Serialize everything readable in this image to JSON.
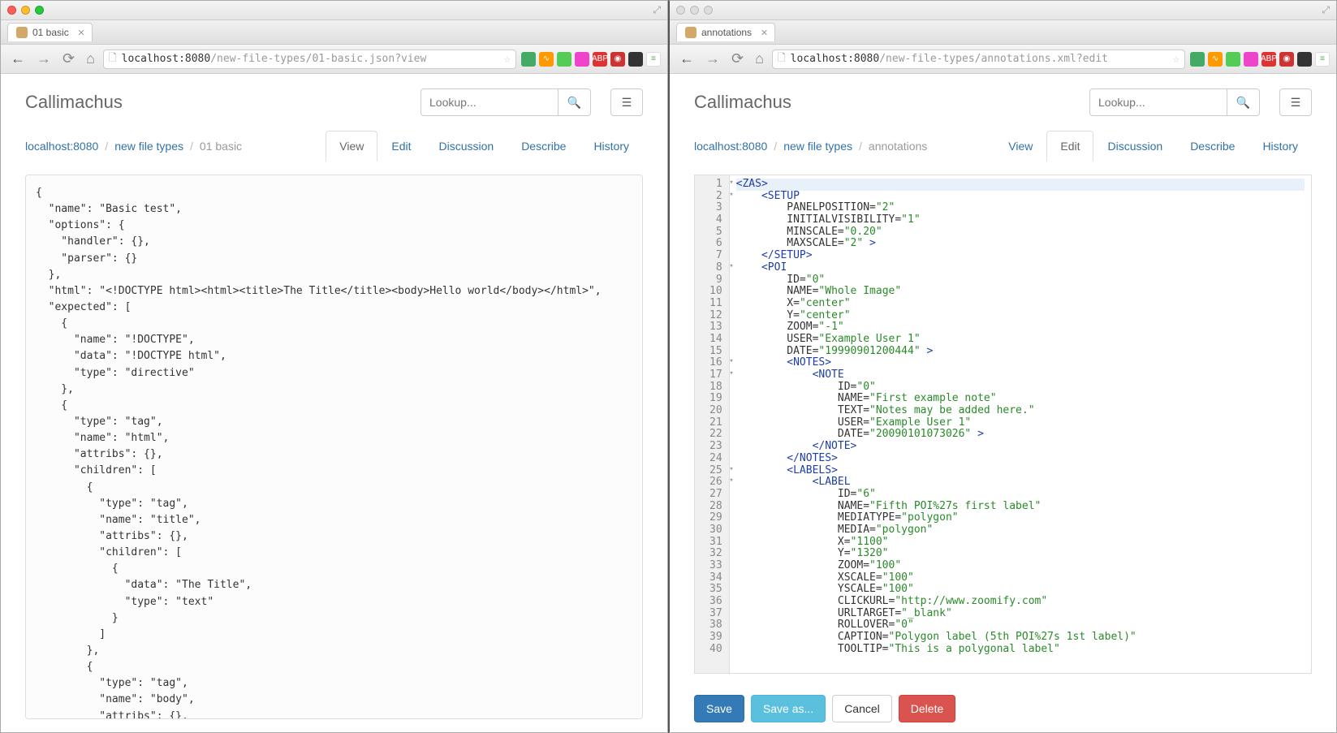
{
  "left": {
    "tab_title": "01 basic",
    "url_host": "localhost",
    "url_port": ":8080",
    "url_path": "/new-file-types/01-basic.json?view",
    "app_title": "Callimachus",
    "lookup_placeholder": "Lookup...",
    "breadcrumb": {
      "a": "localhost:8080",
      "b": "new file types",
      "c": "01 basic"
    },
    "tabs": [
      "View",
      "Edit",
      "Discussion",
      "Describe",
      "History"
    ],
    "active_tab": "View",
    "json_text": "{\n  \"name\": \"Basic test\",\n  \"options\": {\n    \"handler\": {},\n    \"parser\": {}\n  },\n  \"html\": \"<!DOCTYPE html><html><title>The Title</title><body>Hello world</body></html>\",\n  \"expected\": [\n    {\n      \"name\": \"!DOCTYPE\",\n      \"data\": \"!DOCTYPE html\",\n      \"type\": \"directive\"\n    },\n    {\n      \"type\": \"tag\",\n      \"name\": \"html\",\n      \"attribs\": {},\n      \"children\": [\n        {\n          \"type\": \"tag\",\n          \"name\": \"title\",\n          \"attribs\": {},\n          \"children\": [\n            {\n              \"data\": \"The Title\",\n              \"type\": \"text\"\n            }\n          ]\n        },\n        {\n          \"type\": \"tag\",\n          \"name\": \"body\",\n          \"attribs\": {},\n          \"children\": [\n            {\n              \"data\": \"Hello world\",\n              \"type\": \"text\""
  },
  "right": {
    "tab_title": "annotations",
    "url_host": "localhost",
    "url_port": ":8080",
    "url_path": "/new-file-types/annotations.xml?edit",
    "app_title": "Callimachus",
    "lookup_placeholder": "Lookup...",
    "breadcrumb": {
      "a": "localhost:8080",
      "b": "new file types",
      "c": "annotations"
    },
    "tabs": [
      "View",
      "Edit",
      "Discussion",
      "Describe",
      "History"
    ],
    "active_tab": "Edit",
    "buttons": {
      "save": "Save",
      "saveas": "Save as...",
      "cancel": "Cancel",
      "delete": "Delete"
    },
    "code_lines": [
      {
        "n": 1,
        "fold": true,
        "hl": true,
        "parts": [
          {
            "c": "t-tag",
            "t": "<ZAS>"
          }
        ]
      },
      {
        "n": 2,
        "fold": true,
        "parts": [
          {
            "t": "    "
          },
          {
            "c": "t-tag",
            "t": "<SETUP"
          }
        ]
      },
      {
        "n": 3,
        "parts": [
          {
            "t": "        "
          },
          {
            "c": "t-attr",
            "t": "PANELPOSITION="
          },
          {
            "c": "t-str",
            "t": "\"2\""
          }
        ]
      },
      {
        "n": 4,
        "parts": [
          {
            "t": "        "
          },
          {
            "c": "t-attr",
            "t": "INITIALVISIBILITY="
          },
          {
            "c": "t-str",
            "t": "\"1\""
          }
        ]
      },
      {
        "n": 5,
        "parts": [
          {
            "t": "        "
          },
          {
            "c": "t-attr",
            "t": "MINSCALE="
          },
          {
            "c": "t-str",
            "t": "\"0.20\""
          }
        ]
      },
      {
        "n": 6,
        "parts": [
          {
            "t": "        "
          },
          {
            "c": "t-attr",
            "t": "MAXSCALE="
          },
          {
            "c": "t-str",
            "t": "\"2\""
          },
          {
            "c": "t-tag",
            "t": " >"
          }
        ]
      },
      {
        "n": 7,
        "parts": [
          {
            "t": "    "
          },
          {
            "c": "t-tag",
            "t": "</SETUP>"
          }
        ]
      },
      {
        "n": 8,
        "fold": true,
        "parts": [
          {
            "t": "    "
          },
          {
            "c": "t-tag",
            "t": "<POI"
          }
        ]
      },
      {
        "n": 9,
        "parts": [
          {
            "t": "        "
          },
          {
            "c": "t-attr",
            "t": "ID="
          },
          {
            "c": "t-str",
            "t": "\"0\""
          }
        ]
      },
      {
        "n": 10,
        "parts": [
          {
            "t": "        "
          },
          {
            "c": "t-attr",
            "t": "NAME="
          },
          {
            "c": "t-str",
            "t": "\"Whole Image\""
          }
        ]
      },
      {
        "n": 11,
        "parts": [
          {
            "t": "        "
          },
          {
            "c": "t-attr",
            "t": "X="
          },
          {
            "c": "t-str",
            "t": "\"center\""
          }
        ]
      },
      {
        "n": 12,
        "parts": [
          {
            "t": "        "
          },
          {
            "c": "t-attr",
            "t": "Y="
          },
          {
            "c": "t-str",
            "t": "\"center\""
          }
        ]
      },
      {
        "n": 13,
        "parts": [
          {
            "t": "        "
          },
          {
            "c": "t-attr",
            "t": "ZOOM="
          },
          {
            "c": "t-str",
            "t": "\"-1\""
          }
        ]
      },
      {
        "n": 14,
        "parts": [
          {
            "t": "        "
          },
          {
            "c": "t-attr",
            "t": "USER="
          },
          {
            "c": "t-str",
            "t": "\"Example User 1\""
          }
        ]
      },
      {
        "n": 15,
        "parts": [
          {
            "t": "        "
          },
          {
            "c": "t-attr",
            "t": "DATE="
          },
          {
            "c": "t-str",
            "t": "\"19990901200444\""
          },
          {
            "c": "t-tag",
            "t": " >"
          }
        ]
      },
      {
        "n": 16,
        "fold": true,
        "parts": [
          {
            "t": "        "
          },
          {
            "c": "t-tag",
            "t": "<NOTES>"
          }
        ]
      },
      {
        "n": 17,
        "fold": true,
        "parts": [
          {
            "t": "            "
          },
          {
            "c": "t-tag",
            "t": "<NOTE"
          }
        ]
      },
      {
        "n": 18,
        "parts": [
          {
            "t": "                "
          },
          {
            "c": "t-attr",
            "t": "ID="
          },
          {
            "c": "t-str",
            "t": "\"0\""
          }
        ]
      },
      {
        "n": 19,
        "parts": [
          {
            "t": "                "
          },
          {
            "c": "t-attr",
            "t": "NAME="
          },
          {
            "c": "t-str",
            "t": "\"First example note\""
          }
        ]
      },
      {
        "n": 20,
        "parts": [
          {
            "t": "                "
          },
          {
            "c": "t-attr",
            "t": "TEXT="
          },
          {
            "c": "t-str",
            "t": "\"Notes may be added here.\""
          }
        ]
      },
      {
        "n": 21,
        "parts": [
          {
            "t": "                "
          },
          {
            "c": "t-attr",
            "t": "USER="
          },
          {
            "c": "t-str",
            "t": "\"Example User 1\""
          }
        ]
      },
      {
        "n": 22,
        "parts": [
          {
            "t": "                "
          },
          {
            "c": "t-attr",
            "t": "DATE="
          },
          {
            "c": "t-str",
            "t": "\"20090101073026\""
          },
          {
            "c": "t-tag",
            "t": " >"
          }
        ]
      },
      {
        "n": 23,
        "parts": [
          {
            "t": "            "
          },
          {
            "c": "t-tag",
            "t": "</NOTE>"
          }
        ]
      },
      {
        "n": 24,
        "parts": [
          {
            "t": "        "
          },
          {
            "c": "t-tag",
            "t": "</NOTES>"
          }
        ]
      },
      {
        "n": 25,
        "fold": true,
        "parts": [
          {
            "t": "        "
          },
          {
            "c": "t-tag",
            "t": "<LABELS>"
          }
        ]
      },
      {
        "n": 26,
        "fold": true,
        "parts": [
          {
            "t": "            "
          },
          {
            "c": "t-tag",
            "t": "<LABEL"
          }
        ]
      },
      {
        "n": 27,
        "parts": [
          {
            "t": "                "
          },
          {
            "c": "t-attr",
            "t": "ID="
          },
          {
            "c": "t-str",
            "t": "\"6\""
          }
        ]
      },
      {
        "n": 28,
        "parts": [
          {
            "t": "                "
          },
          {
            "c": "t-attr",
            "t": "NAME="
          },
          {
            "c": "t-str",
            "t": "\"Fifth POI%27s first label\""
          }
        ]
      },
      {
        "n": 29,
        "parts": [
          {
            "t": "                "
          },
          {
            "c": "t-attr",
            "t": "MEDIATYPE="
          },
          {
            "c": "t-str",
            "t": "\"polygon\""
          }
        ]
      },
      {
        "n": 30,
        "parts": [
          {
            "t": "                "
          },
          {
            "c": "t-attr",
            "t": "MEDIA="
          },
          {
            "c": "t-str",
            "t": "\"polygon\""
          }
        ]
      },
      {
        "n": 31,
        "parts": [
          {
            "t": "                "
          },
          {
            "c": "t-attr",
            "t": "X="
          },
          {
            "c": "t-str",
            "t": "\"1100\""
          }
        ]
      },
      {
        "n": 32,
        "parts": [
          {
            "t": "                "
          },
          {
            "c": "t-attr",
            "t": "Y="
          },
          {
            "c": "t-str",
            "t": "\"1320\""
          }
        ]
      },
      {
        "n": 33,
        "parts": [
          {
            "t": "                "
          },
          {
            "c": "t-attr",
            "t": "ZOOM="
          },
          {
            "c": "t-str",
            "t": "\"100\""
          }
        ]
      },
      {
        "n": 34,
        "parts": [
          {
            "t": "                "
          },
          {
            "c": "t-attr",
            "t": "XSCALE="
          },
          {
            "c": "t-str",
            "t": "\"100\""
          }
        ]
      },
      {
        "n": 35,
        "parts": [
          {
            "t": "                "
          },
          {
            "c": "t-attr",
            "t": "YSCALE="
          },
          {
            "c": "t-str",
            "t": "\"100\""
          }
        ]
      },
      {
        "n": 36,
        "parts": [
          {
            "t": "                "
          },
          {
            "c": "t-attr",
            "t": "CLICKURL="
          },
          {
            "c": "t-str",
            "t": "\"http://www.zoomify.com\""
          }
        ]
      },
      {
        "n": 37,
        "parts": [
          {
            "t": "                "
          },
          {
            "c": "t-attr",
            "t": "URLTARGET="
          },
          {
            "c": "t-str",
            "t": "\"_blank\""
          }
        ]
      },
      {
        "n": 38,
        "parts": [
          {
            "t": "                "
          },
          {
            "c": "t-attr",
            "t": "ROLLOVER="
          },
          {
            "c": "t-str",
            "t": "\"0\""
          }
        ]
      },
      {
        "n": 39,
        "parts": [
          {
            "t": "                "
          },
          {
            "c": "t-attr",
            "t": "CAPTION="
          },
          {
            "c": "t-str",
            "t": "\"Polygon label (5th POI%27s 1st label)\""
          }
        ]
      },
      {
        "n": 40,
        "parts": [
          {
            "t": "                "
          },
          {
            "c": "t-attr",
            "t": "TOOLTIP="
          },
          {
            "c": "t-str",
            "t": "\"This is a polygonal label\""
          }
        ]
      }
    ]
  }
}
